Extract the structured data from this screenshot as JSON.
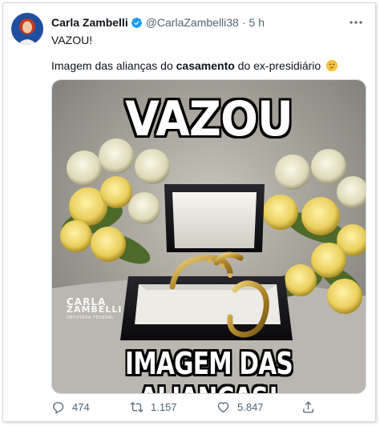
{
  "tweet": {
    "author_name": "Carla Zambelli",
    "handle": "@CarlaZambelli38",
    "separator": "·",
    "time": "5 h",
    "text_line1": "VAZOU!",
    "text_line2_pre": "Imagem das alianças do ",
    "text_line2_bold": "casamento",
    "text_line2_post": " do ex-presidiário"
  },
  "media": {
    "caption_top": "VAZOU",
    "caption_bottom": "IMAGEM DAS ALIANÇAS!",
    "watermark": {
      "line1": "CARLA",
      "line2": "ZAMBELLI",
      "line3": "DEPUTADA FEDERAL"
    }
  },
  "actions": {
    "replies": "474",
    "retweets": "1.157",
    "likes": "5.847"
  },
  "colors": {
    "verified": "#1d9bf0",
    "muted": "#536471",
    "text": "#0f1419"
  }
}
